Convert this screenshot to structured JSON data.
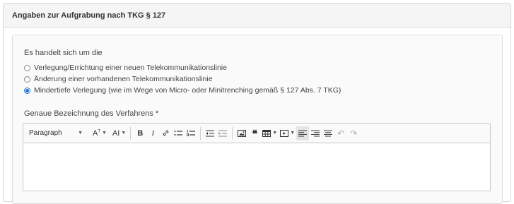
{
  "panel": {
    "title": "Angaben zur Aufgrabung nach TKG § 127"
  },
  "form": {
    "question": "Es handelt sich um die",
    "options": [
      {
        "label": "Verlegung/Errichtung einer neuen Telekommunikationslinie",
        "checked": false
      },
      {
        "label": "Änderung einer vorhandenen Telekommunikationslinie",
        "checked": false
      },
      {
        "label": "Mindertiefe Verlegung (wie im Wege von Micro- oder Minitrenching gemäß § 127 Abs. 7 TKG)",
        "checked": true
      }
    ],
    "field_label": "Genaue Bezeichnung des Verfahrens *"
  },
  "editor": {
    "paragraph_label": "Paragraph",
    "content": ""
  },
  "colors": {
    "accent": "#1e73c8",
    "border": "#d8d8d8",
    "header_bg": "#f5f5f5"
  }
}
